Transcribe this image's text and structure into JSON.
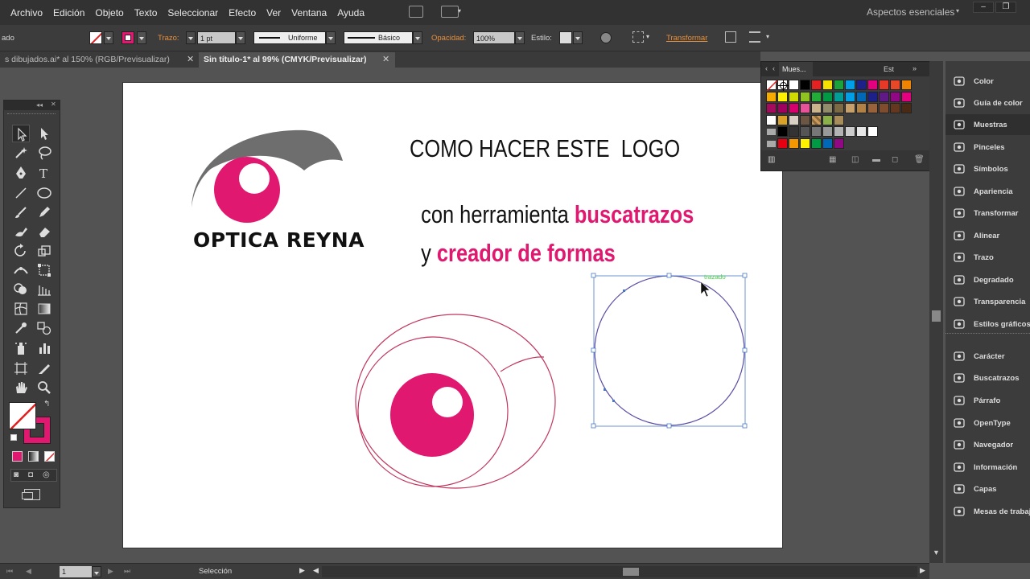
{
  "menubar": {
    "items": [
      "Archivo",
      "Edición",
      "Objeto",
      "Texto",
      "Seleccionar",
      "Efecto",
      "Ver",
      "Ventana",
      "Ayuda"
    ],
    "workspace": "Aspectos esenciales"
  },
  "controlbar": {
    "left_label": "ado",
    "stroke_label": "Trazo:",
    "stroke_weight": "1 pt",
    "profile": "Uniforme",
    "brush": "Básico",
    "opacity_label": "Opacidad:",
    "opacity_value": "100%",
    "style_label": "Estilo:",
    "transform_label": "Transformar"
  },
  "tabs": [
    {
      "label": "s dibujados.ai* al 150% (RGB/Previsualizar)",
      "active": false
    },
    {
      "label": "Sin título-1* al 99% (CMYK/Previsualizar)",
      "active": true
    }
  ],
  "artboard": {
    "logo_text": "OPTICA REYNA",
    "heading_line1": "COMO HACER ESTE  LOGO",
    "heading_line2_plain": "con herramienta ",
    "heading_line2_accent": "buscatrazos",
    "heading_line3_plain": "y ",
    "heading_line3_accent": "creador de formas",
    "hover_hint": "trazado"
  },
  "colors": {
    "brand_pink": "#e0186f",
    "logo_gray": "#6e6e6e",
    "outline_pink": "#c2365f",
    "selection_blue": "#4a79c4"
  },
  "swatches_panel": {
    "tabs": [
      "Mues...",
      "Est"
    ],
    "active_tab": "Mues..."
  },
  "dock": {
    "items": [
      {
        "label": "Color",
        "icon": "color-palette-icon"
      },
      {
        "label": "Guía de color",
        "icon": "color-guide-icon"
      },
      {
        "label": "Muestras",
        "icon": "swatches-grid-icon"
      },
      {
        "label": "Pinceles",
        "icon": "brush-icon"
      },
      {
        "label": "Símbolos",
        "icon": "symbols-icon"
      },
      {
        "label": "Apariencia",
        "icon": "appearance-icon"
      },
      {
        "label": "Transformar",
        "icon": "transform-icon"
      },
      {
        "label": "Alinear",
        "icon": "align-icon"
      },
      {
        "label": "Trazo",
        "icon": "stroke-icon"
      },
      {
        "label": "Degradado",
        "icon": "gradient-icon"
      },
      {
        "label": "Transparencia",
        "icon": "transparency-icon"
      },
      {
        "label": "Estilos gráficos",
        "icon": "graphic-styles-icon"
      },
      {
        "label": "Carácter",
        "icon": "character-icon"
      },
      {
        "label": "Buscatrazos",
        "icon": "pathfinder-icon"
      },
      {
        "label": "Párrafo",
        "icon": "paragraph-icon"
      },
      {
        "label": "OpenType",
        "icon": "opentype-icon"
      },
      {
        "label": "Navegador",
        "icon": "navigator-icon"
      },
      {
        "label": "Información",
        "icon": "info-icon"
      },
      {
        "label": "Capas",
        "icon": "layers-icon"
      },
      {
        "label": "Mesas de trabajo",
        "icon": "artboards-icon"
      }
    ],
    "active": "Muestras"
  },
  "statusbar": {
    "artboard_number": "1",
    "tool": "Selección"
  }
}
